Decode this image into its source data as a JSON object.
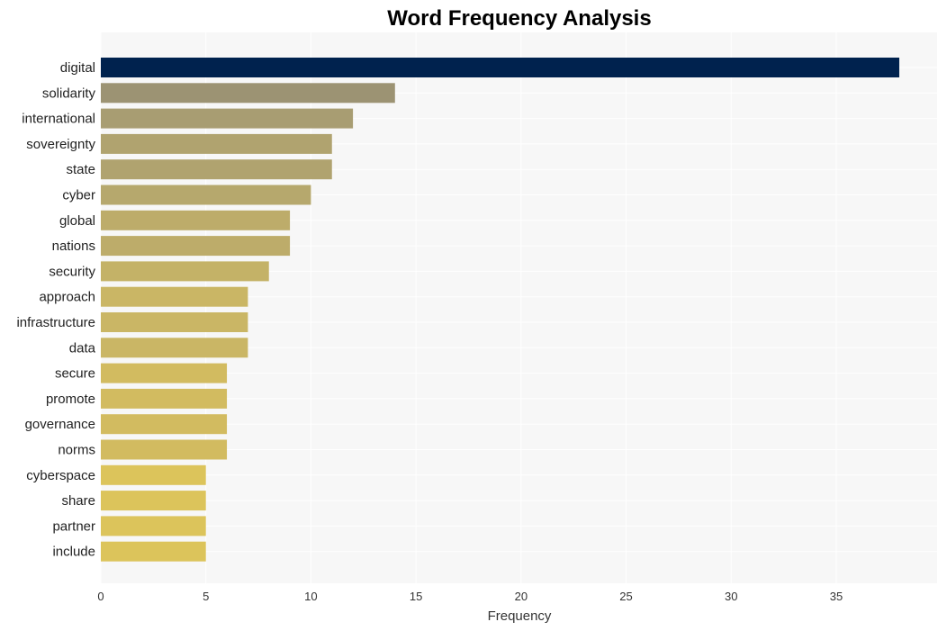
{
  "chart_data": {
    "type": "bar",
    "orientation": "horizontal",
    "title": "Word Frequency Analysis",
    "xlabel": "Frequency",
    "ylabel": "",
    "xlim": [
      0,
      39.8
    ],
    "xticks": [
      0,
      5,
      10,
      15,
      20,
      25,
      30,
      35
    ],
    "grid": true,
    "categories": [
      "digital",
      "solidarity",
      "international",
      "sovereignty",
      "state",
      "cyber",
      "global",
      "nations",
      "security",
      "approach",
      "infrastructure",
      "data",
      "secure",
      "promote",
      "governance",
      "norms",
      "cyberspace",
      "share",
      "partner",
      "include"
    ],
    "values": [
      38,
      14,
      12,
      11,
      11,
      10,
      9,
      9,
      8,
      7,
      7,
      7,
      6,
      6,
      6,
      6,
      5,
      5,
      5,
      5
    ],
    "colors": [
      "#00224e",
      "#9c9373",
      "#a89d72",
      "#b0a36f",
      "#b0a36f",
      "#b6a86d",
      "#bdac6a",
      "#bdac6a",
      "#c4b267",
      "#cab665",
      "#cab665",
      "#cab665",
      "#d2bb60",
      "#d2bb60",
      "#d2bb60",
      "#d2bb60",
      "#dcc45b",
      "#dcc45b",
      "#dcc45b",
      "#dcc45b"
    ]
  }
}
